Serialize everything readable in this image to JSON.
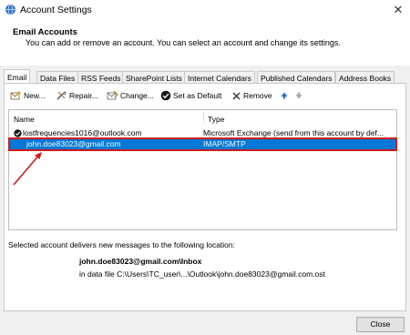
{
  "window": {
    "title": "Account Settings",
    "close_glyph": "✕"
  },
  "header": {
    "title": "Email Accounts",
    "description": "You can add or remove an account. You can select an account and change its settings."
  },
  "tabs": [
    {
      "label": "Email",
      "active": true
    },
    {
      "label": "Data Files"
    },
    {
      "label": "RSS Feeds"
    },
    {
      "label": "SharePoint Lists"
    },
    {
      "label": "Internet Calendars"
    },
    {
      "label": "Published Calendars"
    },
    {
      "label": "Address Books"
    }
  ],
  "toolbar": {
    "new_label": "New...",
    "repair_label": "Repair...",
    "change_label": "Change...",
    "default_label": "Set as Default",
    "remove_label": "Remove",
    "up_icon": "arrow-up-icon",
    "down_icon": "arrow-down-icon"
  },
  "list": {
    "col_name": "Name",
    "col_type": "Type",
    "rows": [
      {
        "name": "lostfrequencies1016@outlook.com",
        "type": "Microsoft Exchange (send from this account by def...",
        "default": true
      },
      {
        "name": "john.doe83023@gmail.com",
        "type": "IMAP/SMTP",
        "selected": true
      }
    ]
  },
  "location": {
    "label": "Selected account delivers new messages to the following location:",
    "path": "john.doe83023@gmail.com\\Inbox",
    "file": "in data file C:\\Users\\TC_user\\...\\Outlook\\john.doe83023@gmail.com.ost"
  },
  "buttons": {
    "close_label": "Close"
  },
  "colors": {
    "selection": "#0078d7",
    "highlight_box": "#d21a1a",
    "arrow": "#d21a1a",
    "up_arrow": "#2b6fd6"
  }
}
